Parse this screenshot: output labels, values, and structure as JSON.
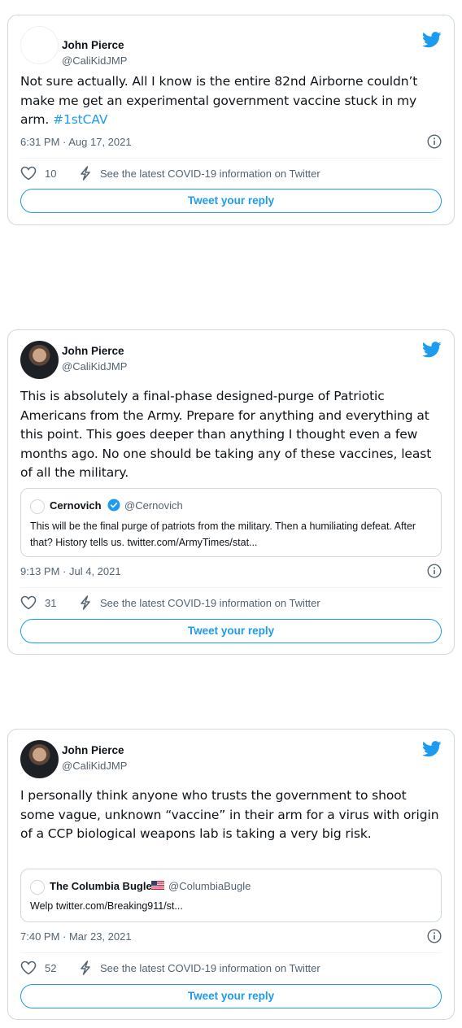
{
  "tweets": [
    {
      "display_name": "John Pierce",
      "handle": "@CaliKidJMP",
      "text_before": "Not sure actually. All I know is the entire 82nd Airborne couldn’t make me get an experimental government vaccine stuck in my arm. ",
      "hashtag": "#1stCAV",
      "timestamp": "6:31 PM · Aug 17, 2021",
      "likes": "10",
      "covid_info": "See the latest COVID-19 information on Twitter",
      "reply_label": "Tweet your reply"
    },
    {
      "display_name": "John Pierce",
      "handle": "@CaliKidJMP",
      "text": "This is absolutely a final-phase designed-purge of Patriotic Americans from the Army. Prepare for anything and everything at this point. This goes deeper than anything I thought even a few months ago. No one should be taking any of these vaccines, least of all the military.",
      "quote": {
        "name": "Cernovich",
        "handle": "@Cernovich",
        "verified": true,
        "text": "This will be the final purge of patriots from the military. Then a humiliating defeat. After that? History tells us. twitter.com/ArmyTimes/stat..."
      },
      "timestamp": "9:13 PM · Jul 4, 2021",
      "likes": "31",
      "covid_info": "See the latest COVID-19 information on Twitter",
      "reply_label": "Tweet your reply"
    },
    {
      "display_name": "John Pierce",
      "handle": "@CaliKidJMP",
      "text": "I personally think anyone who trusts the government to shoot some vague, unknown “vaccine” in their arm for a virus with origin of a CCP biological weapons lab is taking a very big risk.",
      "quote": {
        "name": "The Columbia Bugle",
        "flag": "us-flag-icon",
        "handle": "@ColumbiaBugle",
        "text": "Welp twitter.com/Breaking911/st..."
      },
      "timestamp": "7:40 PM · Mar 23, 2021",
      "likes": "52",
      "covid_info": "See the latest COVID-19 information on Twitter",
      "reply_label": "Tweet your reply"
    }
  ],
  "colors": {
    "accent": "#1d9bf0",
    "secondary_text": "#536471",
    "border": "#cfd9de"
  }
}
